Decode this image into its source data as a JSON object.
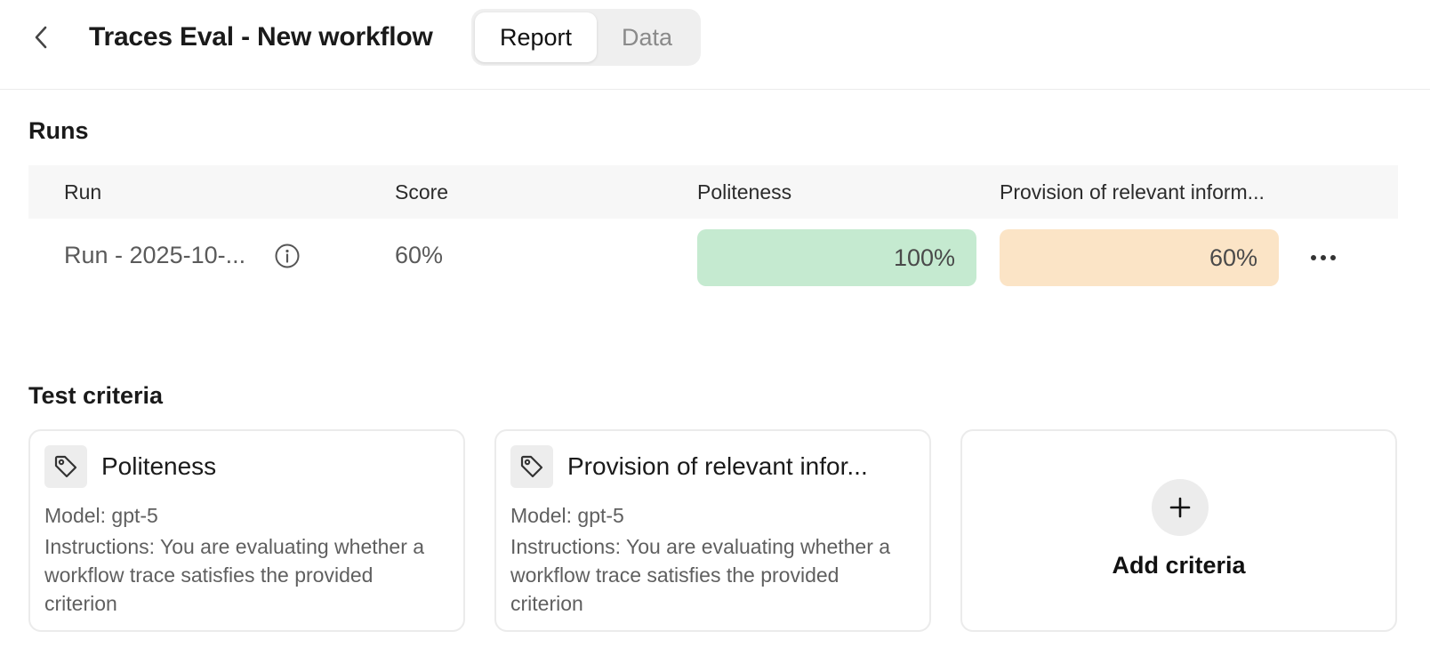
{
  "header": {
    "title": "Traces Eval - New workflow",
    "tabs": [
      {
        "label": "Report",
        "active": true
      },
      {
        "label": "Data",
        "active": false
      }
    ]
  },
  "runs": {
    "section_title": "Runs",
    "columns": [
      "Run",
      "Score",
      "Politeness",
      "Provision of relevant inform..."
    ],
    "rows": [
      {
        "run": "Run - 2025-10-...",
        "score": "60%",
        "politeness": "100%",
        "provision": "60%"
      }
    ]
  },
  "criteria": {
    "section_title": "Test criteria",
    "cards": [
      {
        "name": "Politeness",
        "model": "Model: gpt-5",
        "instructions": "Instructions: You are evaluating whether a workflow trace satisfies the provided criterion"
      },
      {
        "name": "Provision of relevant infor...",
        "model": "Model: gpt-5",
        "instructions": "Instructions: You are evaluating whether a workflow trace satisfies the provided criterion"
      }
    ],
    "add_label": "Add criteria"
  },
  "colors": {
    "pass": "#c5ead0",
    "partial": "#fbe4c6"
  }
}
